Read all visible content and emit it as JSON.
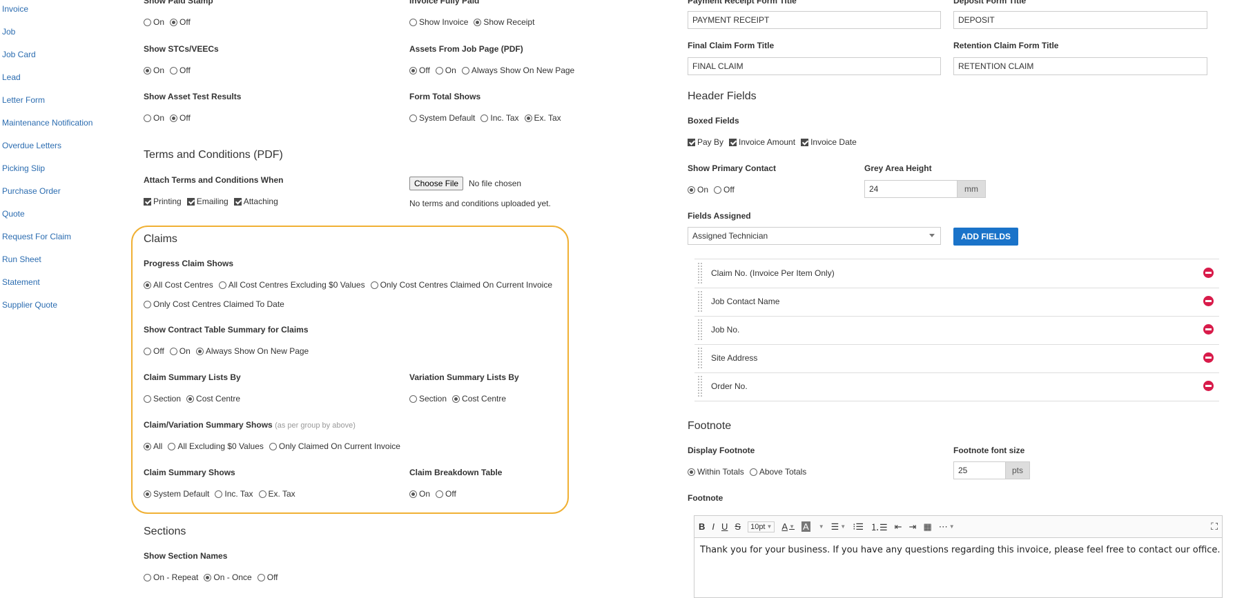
{
  "sidebar": {
    "items": [
      "Invoice",
      "Job",
      "Job Card",
      "Lead",
      "Letter Form",
      "Maintenance Notification",
      "Overdue Letters",
      "Picking Slip",
      "Purchase Order",
      "Quote",
      "Request For Claim",
      "Run Sheet",
      "Statement",
      "Supplier Quote"
    ]
  },
  "left": {
    "show_paid_stamp": {
      "label": "Show Paid Stamp",
      "options": [
        "On",
        "Off"
      ],
      "selected": 1
    },
    "invoice_fully_paid": {
      "label": "Invoice Fully Paid",
      "options": [
        "Show Invoice",
        "Show Receipt"
      ],
      "selected": 1
    },
    "show_stcs": {
      "label": "Show STCs/VEECs",
      "options": [
        "On",
        "Off"
      ],
      "selected": 0
    },
    "assets_from_job": {
      "label": "Assets From Job Page (PDF)",
      "options": [
        "Off",
        "On",
        "Always Show On New Page"
      ],
      "selected": 0
    },
    "show_asset_test": {
      "label": "Show Asset Test Results",
      "options": [
        "On",
        "Off"
      ],
      "selected": 1
    },
    "form_total_shows": {
      "label": "Form Total Shows",
      "options": [
        "System Default",
        "Inc. Tax",
        "Ex. Tax"
      ],
      "selected": 2
    },
    "terms_title": "Terms and Conditions (PDF)",
    "attach_terms": {
      "label": "Attach Terms and Conditions When",
      "options": [
        "Printing",
        "Emailing",
        "Attaching"
      ]
    },
    "choose_file": "Choose File",
    "no_file": "No file chosen",
    "no_terms": "No terms and conditions uploaded yet.",
    "claims_title": "Claims",
    "progress_claim": {
      "label": "Progress Claim Shows",
      "options": [
        "All Cost Centres",
        "All Cost Centres Excluding $0 Values",
        "Only Cost Centres Claimed On Current Invoice",
        "Only Cost Centres Claimed To Date"
      ],
      "selected": 0
    },
    "contract_table": {
      "label": "Show Contract Table Summary for Claims",
      "options": [
        "Off",
        "On",
        "Always Show On New Page"
      ],
      "selected": 2
    },
    "claim_summary_by": {
      "label": "Claim Summary Lists By",
      "options": [
        "Section",
        "Cost Centre"
      ],
      "selected": 1
    },
    "variation_summary_by": {
      "label": "Variation Summary Lists By",
      "options": [
        "Section",
        "Cost Centre"
      ],
      "selected": 1
    },
    "claim_var_shows": {
      "label": "Claim/Variation Summary Shows",
      "hint": "(as per group by above)",
      "options": [
        "All",
        "All Excluding $0 Values",
        "Only Claimed On Current Invoice"
      ],
      "selected": 0
    },
    "claim_summary_shows": {
      "label": "Claim Summary Shows",
      "options": [
        "System Default",
        "Inc. Tax",
        "Ex. Tax"
      ],
      "selected": 0
    },
    "claim_breakdown": {
      "label": "Claim Breakdown Table",
      "options": [
        "On",
        "Off"
      ],
      "selected": 0
    },
    "sections_title": "Sections",
    "show_section_names": {
      "label": "Show Section Names",
      "options": [
        "On - Repeat",
        "On - Once",
        "Off"
      ],
      "selected": 1
    }
  },
  "right": {
    "payment_receipt_label": "Payment Receipt Form Title",
    "payment_receipt_value": "PAYMENT RECEIPT",
    "deposit_label": "Deposit Form Title",
    "deposit_value": "DEPOSIT",
    "final_claim_label": "Final Claim Form Title",
    "final_claim_value": "FINAL CLAIM",
    "retention_label": "Retention Claim Form Title",
    "retention_value": "RETENTION CLAIM",
    "header_fields_title": "Header Fields",
    "boxed_fields": {
      "label": "Boxed Fields",
      "options": [
        "Pay By",
        "Invoice Amount",
        "Invoice Date"
      ]
    },
    "primary_contact": {
      "label": "Show Primary Contact",
      "options": [
        "On",
        "Off"
      ],
      "selected": 0
    },
    "grey_area_label": "Grey Area Height",
    "grey_area_value": "24",
    "grey_area_unit": "mm",
    "fields_assigned_label": "Fields Assigned",
    "fields_assigned_value": "Assigned Technician",
    "add_fields": "ADD FIELDS",
    "fields": [
      "Claim No. (Invoice Per Item Only)",
      "Job Contact Name",
      "Job No.",
      "Site Address",
      "Order No."
    ],
    "footnote_title": "Footnote",
    "display_footnote": {
      "label": "Display Footnote",
      "options": [
        "Within Totals",
        "Above Totals"
      ],
      "selected": 0
    },
    "footnote_font_label": "Footnote font size",
    "footnote_font_value": "25",
    "footnote_font_unit": "pts",
    "footnote_label": "Footnote",
    "editor": {
      "font_size": "10pt",
      "text": "Thank you for your business. If you have any questions regarding this invoice, please feel free to contact our office."
    }
  }
}
